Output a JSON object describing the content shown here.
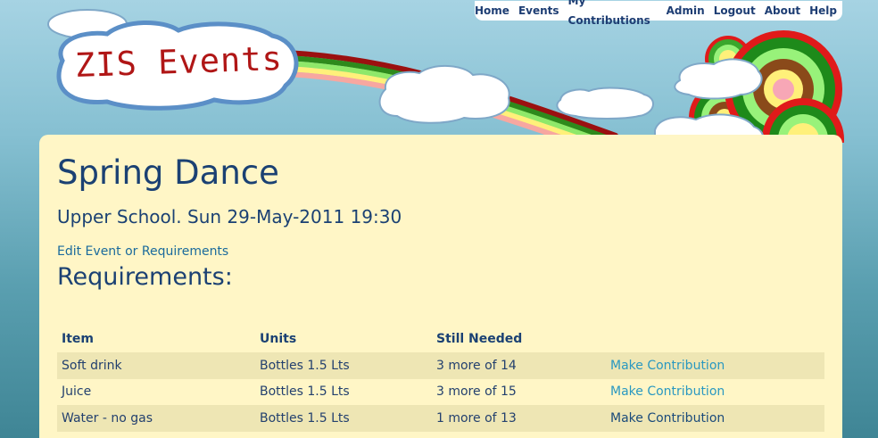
{
  "app": {
    "logo_text": "ZIS Events"
  },
  "nav": {
    "items": [
      {
        "label": "Home"
      },
      {
        "label": "Events"
      },
      {
        "label": "My Contributions"
      },
      {
        "label": "Admin"
      },
      {
        "label": "Logout"
      },
      {
        "label": "About"
      },
      {
        "label": "Help"
      }
    ]
  },
  "event": {
    "title": "Spring Dance",
    "subtitle": "Upper School. Sun 29-May-2011 19:30",
    "edit_link": "Edit Event or Requirements",
    "requirements_heading": "Requirements:"
  },
  "requirements_table": {
    "headers": [
      "Item",
      "Units",
      "Still Needed",
      ""
    ],
    "rows": [
      {
        "item": "Soft drink",
        "units": "Bottles 1.5 Lts",
        "still_needed": "3 more of 14",
        "action": "Make Contribution"
      },
      {
        "item": "Juice",
        "units": "Bottles 1.5 Lts",
        "still_needed": "3 more of 15",
        "action": "Make Contribution"
      },
      {
        "item": "Water - no gas",
        "units": "Bottles 1.5 Lts",
        "still_needed": "1 more of 13",
        "action": "Make Contribution"
      }
    ]
  },
  "colors": {
    "sky_top": "#a6d3e3",
    "panel_bg": "#fff6c6",
    "heading": "#1b4173",
    "link": "#2a98c1",
    "logo_red": "#b01616"
  }
}
